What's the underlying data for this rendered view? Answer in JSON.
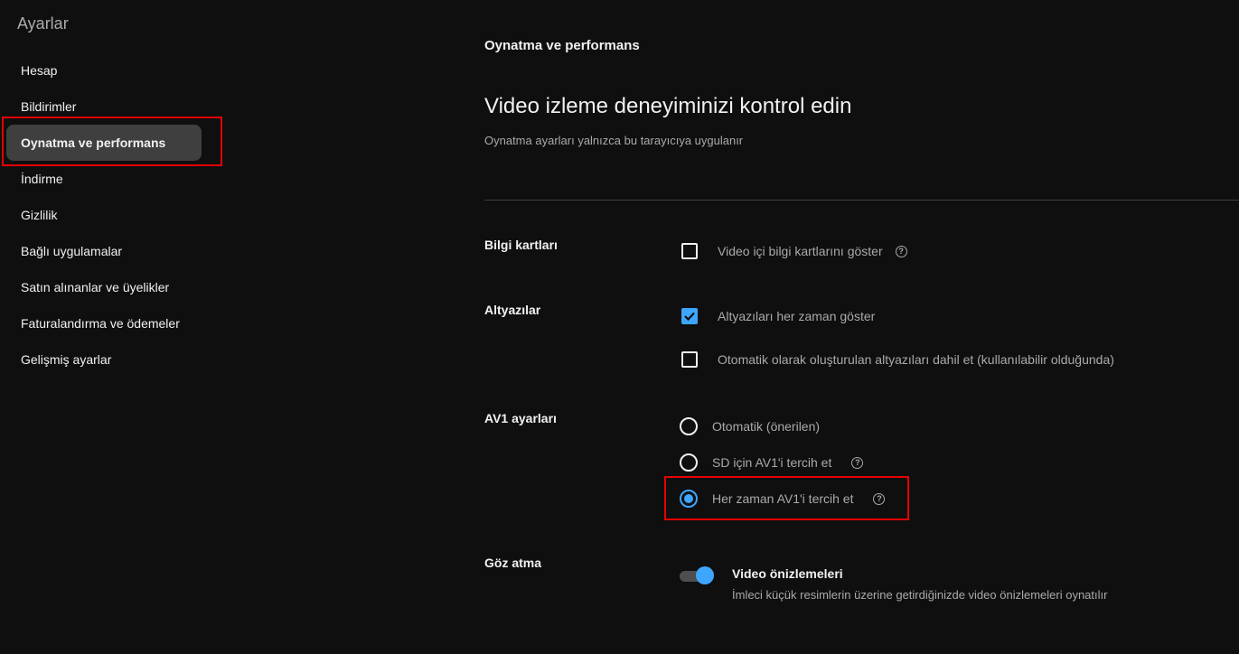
{
  "sidebar": {
    "title": "Ayarlar",
    "items": [
      {
        "label": "Hesap"
      },
      {
        "label": "Bildirimler"
      },
      {
        "label": "Oynatma ve performans"
      },
      {
        "label": "İndirme"
      },
      {
        "label": "Gizlilik"
      },
      {
        "label": "Bağlı uygulamalar"
      },
      {
        "label": "Satın alınanlar ve üyelikler"
      },
      {
        "label": "Faturalandırma ve ödemeler"
      },
      {
        "label": "Gelişmiş ayarlar"
      }
    ],
    "active_index": 2
  },
  "main": {
    "heading": "Oynatma ve performans",
    "title": "Video izleme deneyiminizi kontrol edin",
    "subtitle": "Oynatma ayarları yalnızca bu tarayıcıya uygulanır",
    "info_cards": {
      "label": "Bilgi kartları",
      "option": "Video içi bilgi kartlarını göster",
      "checked": false
    },
    "captions": {
      "label": "Altyazılar",
      "option1": "Altyazıları her zaman göster",
      "option1_checked": true,
      "option2": "Otomatik olarak oluşturulan altyazıları dahil et (kullanılabilir olduğunda)",
      "option2_checked": false
    },
    "av1": {
      "label": "AV1 ayarları",
      "options": [
        {
          "label": "Otomatik (önerilen)"
        },
        {
          "label": "SD için AV1'i tercih et"
        },
        {
          "label": "Her zaman AV1'i tercih et"
        }
      ],
      "selected_index": 2
    },
    "peek": {
      "label": "Göz atma",
      "toggle_title": "Video önizlemeleri",
      "toggle_desc": "İmleci küçük resimlerin üzerine getirdiğinizde video önizlemeleri oynatılır",
      "on": true
    },
    "help_glyph": "?"
  },
  "colors": {
    "background": "#0f0f0f",
    "accent": "#3ea6ff",
    "highlight": "#e60000",
    "active_nav": "#3f3f3f"
  }
}
